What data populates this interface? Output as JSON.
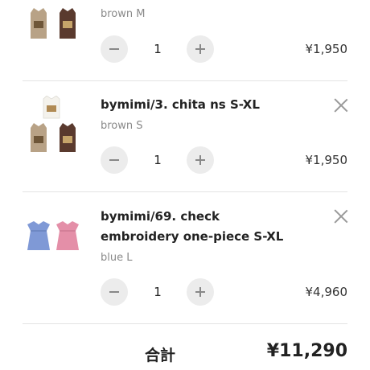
{
  "cart": {
    "items": [
      {
        "title": "",
        "variant": "brown M",
        "quantity": "1",
        "price": "¥1,950",
        "image": "three tank tops: white, beige, brown"
      },
      {
        "title": "bymimi/3. chita ns S-XL",
        "variant": "brown S",
        "quantity": "1",
        "price": "¥1,950",
        "image": "three tank tops: white, beige, brown"
      },
      {
        "title": "bymimi/69. check embroidery one-piece S-XL",
        "variant": "blue L",
        "quantity": "1",
        "price": "¥4,960",
        "image": "two gingham dresses: blue, pink"
      }
    ],
    "total_label": "合計",
    "total_amount": "¥11,290"
  },
  "icons": {
    "remove": "close-icon",
    "decrease": "minus-icon",
    "increase": "plus-icon"
  },
  "colors": {
    "stepper_bg": "#ececec",
    "divider": "#e4e4e4",
    "variant_text": "#8a8a8a"
  }
}
